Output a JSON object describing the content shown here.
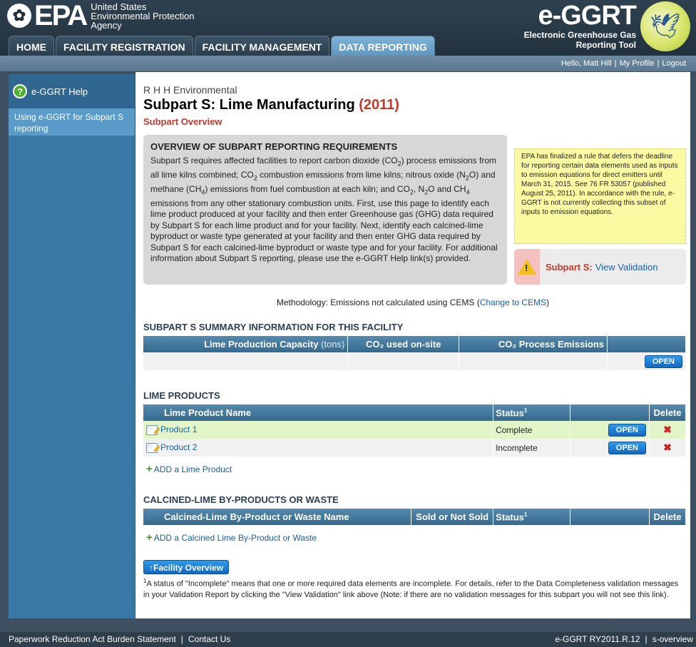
{
  "header": {
    "epa_mark": "EPA",
    "agency_line1": "United States",
    "agency_line2": "Environmental Protection",
    "agency_line3": "Agency",
    "app_name": "e-GGRT",
    "app_sub1": "Electronic Greenhouse Gas",
    "app_sub2": "Reporting Tool"
  },
  "tabs": [
    {
      "label": "HOME"
    },
    {
      "label": "FACILITY REGISTRATION"
    },
    {
      "label": "FACILITY MANAGEMENT"
    },
    {
      "label": "DATA REPORTING"
    }
  ],
  "userbar": {
    "greeting": "Hello, Matt Hill",
    "profile": "My Profile",
    "logout": "Logout"
  },
  "sidebar": {
    "help_label": "e-GGRT Help",
    "link": "Using e-GGRT for Subpart S reporting"
  },
  "page": {
    "company": "R H H Environmental",
    "title": "Subpart S: Lime Manufacturing",
    "year": "(2011)",
    "subtitle": "Subpart Overview"
  },
  "overview": {
    "heading": "OVERVIEW OF SUBPART REPORTING REQUIREMENTS",
    "t1": "Subpart S requires affected facilities to report carbon dioxide (CO",
    "t2": ") process emissions from all lime kilns combined; CO",
    "t3": " combustion emissions from lime kilns; nitrous oxide (N",
    "t4": "O) and methane (CH",
    "t5": ") emissions from fuel combustion at each kiln; and CO",
    "t6": ", N",
    "t7": "O and CH",
    "t8": " emissions from any other stationary combustion units. First, use this page to identify each lime product produced at your facility and then enter Greenhouse gas (GHG) data required by Subpart S for each lime product and for your facility. Next, identify each calcined-lime byproduct or waste type generated at your facility and then enter GHG data required by Subpart S for each calcined-lime byproduct or waste type and for your facility. For additional information about Subpart S reporting, please use the e-GGRT Help link(s) provided.",
    "sub2": "2",
    "sub4": "4"
  },
  "notice": "EPA has finalized a rule that defers the deadline for reporting certain data elements used as inputs to emission equations for direct emitters until March 31, 2015. See 76 FR 53057 (published August 25, 2011). In accordance with the rule, e-GGRT is not currently collecting this subset of inputs to emission equations.",
  "validation": {
    "label": "Subpart S:",
    "link": "View Validation",
    "icon_text": "!"
  },
  "methodology": {
    "text": "Methodology: Emissions not calculated using CEMS (",
    "link": "Change to CEMS",
    "close": ")"
  },
  "summary": {
    "heading": "SUBPART S SUMMARY INFORMATION FOR THIS FACILITY",
    "col1": "Lime Production Capacity",
    "col1_unit": "(tons)",
    "col2": "CO₂ used on-site",
    "col3": "CO₂ Process Emissions",
    "open": "OPEN"
  },
  "products": {
    "heading": "LIME PRODUCTS",
    "col_name": "Lime Product Name",
    "col_status": "Status",
    "col_status_sup": "1",
    "col_delete": "Delete",
    "open": "OPEN",
    "rows": [
      {
        "name": "Product 1",
        "status": "Complete"
      },
      {
        "name": "Product 2",
        "status": "Incomplete"
      }
    ],
    "add": "ADD a Lime Product"
  },
  "byproducts": {
    "heading": "CALCINED-LIME BY-PRODUCTS OR WASTE",
    "col_name": "Calcined-Lime By-Product or Waste Name",
    "col_sold": "Sold or Not Sold",
    "col_status": "Status",
    "col_status_sup": "1",
    "col_delete": "Delete",
    "add": "ADD a Calcined Lime By-Product or Waste"
  },
  "facility_button": "Facility Overview",
  "footnote": {
    "sup": "1",
    "text": "A status of \"Incomplete\" means that one or more required data elements are incomplete. For details, refer to the Data Completeness validation messages in your Validation Report by clicking the \"View Validation\" link above (Note: if there are no validation messages for this subpart you will not see this link)."
  },
  "footer": {
    "paperwork": "Paperwork Reduction Act Burden Statement",
    "contact": "Contact Us",
    "version": "e-GGRT RY2011.R.12",
    "page_id": "s-overview"
  }
}
